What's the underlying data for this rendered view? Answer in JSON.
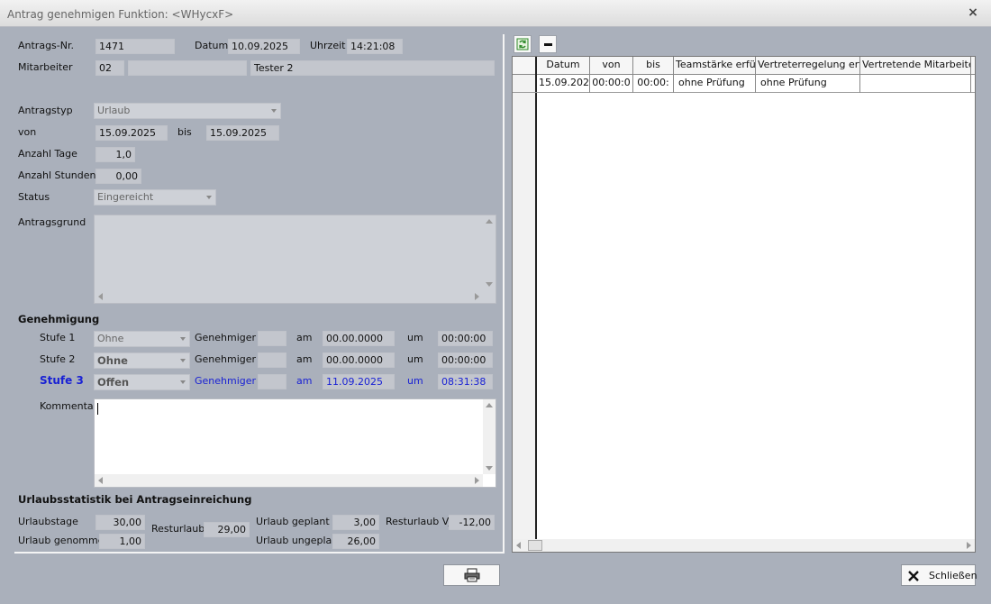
{
  "window": {
    "title": "Antrag genehmigen Funktion: <WHycxF>",
    "close": "×"
  },
  "header": {
    "antrags_nr_label": "Antrags-Nr.",
    "antrags_nr": "1471",
    "datum_label": "Datum",
    "datum": "10.09.2025",
    "uhrzeit_label": "Uhrzeit",
    "uhrzeit": "14:21:08",
    "mitarbeiter_label": "Mitarbeiter",
    "mitarbeiter_nr": "02",
    "mitarbeiter_extra": "",
    "mitarbeiter_name": "Tester 2"
  },
  "antrag": {
    "antragstyp_label": "Antragstyp",
    "antragstyp": "Urlaub",
    "von_label": "von",
    "von": "15.09.2025",
    "bis_label": "bis",
    "bis": "15.09.2025",
    "tage_label": "Anzahl Tage",
    "tage": "1,0",
    "stunden_label": "Anzahl Stunden",
    "stunden": "0,00",
    "status_label": "Status",
    "status": "Eingereicht",
    "grund_label": "Antragsgrund",
    "grund": ""
  },
  "genehmigung": {
    "title": "Genehmigung",
    "genehmiger_label": "Genehmiger",
    "am_label": "am",
    "um_label": "um",
    "stufen": [
      {
        "label": "Stufe 1",
        "value": "Ohne",
        "genehmiger": "",
        "am": "00.00.0000",
        "um": "00:00:00"
      },
      {
        "label": "Stufe 2",
        "value": "Ohne",
        "genehmiger": "",
        "am": "00.00.0000",
        "um": "00:00:00"
      },
      {
        "label": "Stufe 3",
        "value": "Offen",
        "genehmiger": "",
        "am": "11.09.2025",
        "um": "08:31:38"
      }
    ],
    "kommentar_label": "Kommentar",
    "kommentar": ""
  },
  "statistik": {
    "title": "Urlaubsstatistik bei Antragseinreichung",
    "urlaubstage_label": "Urlaubstage",
    "urlaubstage": "30,00",
    "genommen_label": "Urlaub genommen",
    "genommen": "1,00",
    "resturlaub_label": "Resturlaub",
    "resturlaub": "29,00",
    "geplant_label": "Urlaub geplant",
    "geplant": "3,00",
    "ungeplant_label": "Urlaub ungeplant",
    "ungeplant": "26,00",
    "resturlaub_vj_label": "Resturlaub VJ",
    "resturlaub_vj": "-12,00"
  },
  "grid": {
    "columns": [
      "Datum",
      "von",
      "bis",
      "Teamstärke erfüllt",
      "Vertreterregelung erfüllt",
      "Vertretende Mitarbeiter"
    ],
    "rows": [
      [
        "15.09.202",
        "00:00:0",
        "00:00:",
        "ohne Prüfung",
        "ohne Prüfung",
        ""
      ]
    ]
  },
  "buttons": {
    "close_label": "Schließen"
  },
  "colors": {
    "accent_blue": "#1a22d4",
    "panel": "#aab0bb",
    "field": "#c3c6cd"
  }
}
